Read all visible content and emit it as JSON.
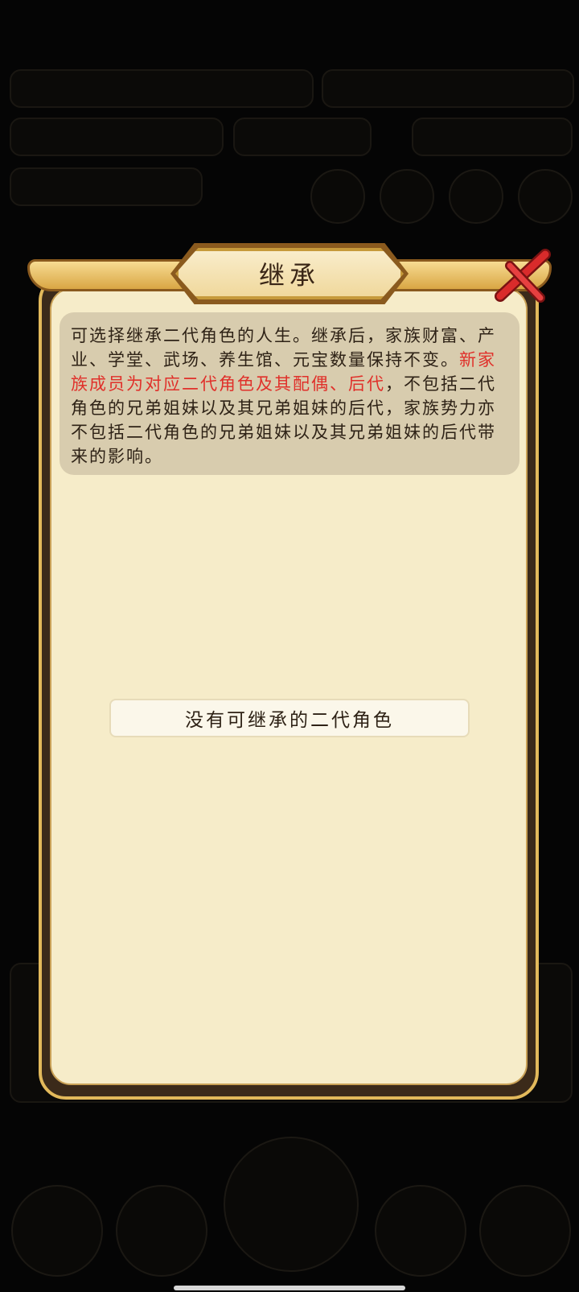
{
  "dialog": {
    "title": "继承",
    "description_before": "可选择继承二代角色的人生。继承后，家族财富、产业、学堂、武场、养生馆、元宝数量保持不变。",
    "description_highlight": "新家族成员为对应二代角色及其配偶、后代",
    "description_after": "，不包括二代角色的兄弟姐妹以及其兄弟姐妹的后代，家族势力亦不包括二代角色的兄弟姐妹以及其兄弟姐妹的后代带来的影响。",
    "empty_message": "没有可继承的二代角色"
  },
  "icons": {
    "close": "close-x-icon"
  },
  "colors": {
    "highlight": "#e0302a",
    "panel_bg": "#f6ecc9",
    "frame_gold": "#e2b95b",
    "close_red": "#d92b2b"
  }
}
